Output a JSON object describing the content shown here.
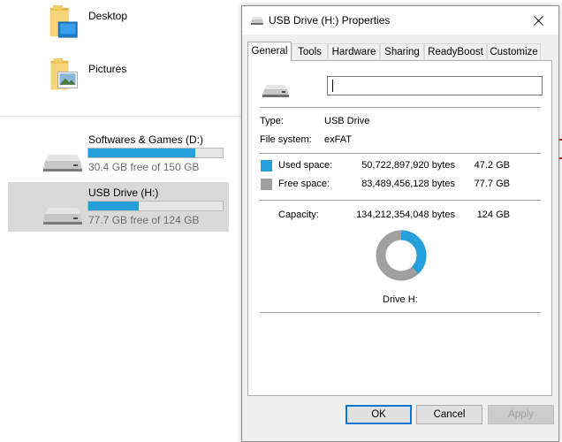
{
  "explorer": {
    "folders": [
      {
        "label": "Desktop",
        "icon": "desktop-folder-icon"
      },
      {
        "label": "Pictures",
        "icon": "pictures-folder-icon"
      }
    ],
    "drives": [
      {
        "name": "Softwares & Games (D:)",
        "free_text": "30.4 GB free of 150 GB",
        "used_fraction": 0.797,
        "icon": "drive-icon"
      },
      {
        "name": "USB Drive (H:)",
        "free_text": "77.7 GB free of 124 GB",
        "used_fraction": 0.373,
        "icon": "drive-icon",
        "selected": true
      }
    ]
  },
  "dialog": {
    "title": "USB Drive (H:) Properties",
    "tabs": [
      "General",
      "Tools",
      "Hardware",
      "Sharing",
      "ReadyBoost",
      "Customize"
    ],
    "active_tab": "General",
    "name_value": "",
    "type_label": "Type:",
    "type_value": "USB Drive",
    "fs_label": "File system:",
    "fs_value": "exFAT",
    "used": {
      "label": "Used space:",
      "bytes": "50,722,897,920 bytes",
      "size": "47.2 GB",
      "color": "#26a0da"
    },
    "free": {
      "label": "Free space:",
      "bytes": "83,489,456,128 bytes",
      "size": "77.7 GB",
      "color": "#a0a0a0"
    },
    "capacity": {
      "label": "Capacity:",
      "bytes": "134,212,354,048 bytes",
      "size": "124 GB"
    },
    "used_fraction": 0.378,
    "drive_label": "Drive H:",
    "buttons": {
      "ok": "OK",
      "cancel": "Cancel",
      "apply": "Apply"
    }
  }
}
